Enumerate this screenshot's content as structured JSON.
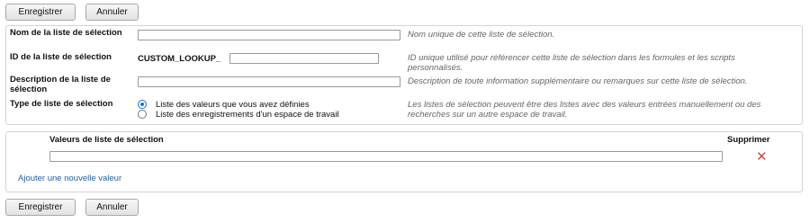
{
  "toolbar": {
    "save_label": "Enregistrer",
    "cancel_label": "Annuler"
  },
  "form": {
    "name": {
      "label": "Nom de la liste de sélection",
      "value": "",
      "help": "Nom unique de cette liste de sélection."
    },
    "id": {
      "label": "ID de la liste de sélection",
      "prefix": "CUSTOM_LOOKUP_",
      "value": "",
      "help": "ID unique utilisé pour référencer cette liste de sélection dans les formules et les scripts personnalisés."
    },
    "description": {
      "label": "Description de la liste de sélection",
      "value": "",
      "help": "Description de toute information supplémentaire ou remarques sur cette liste de sélection."
    },
    "type": {
      "label": "Type de liste de sélection",
      "options": [
        "Liste des valeurs que vous avez définies",
        "Liste des enregistrements d'un espace de travail"
      ],
      "selected_index": 0,
      "help": "Les listes de sélection peuvent être des listes avec des valeurs entrées manuellement ou des recherches sur un autre espace de travail."
    }
  },
  "values_table": {
    "col_values": "Valeurs de liste de sélection",
    "col_delete": "Supprimer",
    "rows": [
      {
        "value": ""
      }
    ],
    "add_link": "Ajouter une nouvelle valeur"
  },
  "icons": {
    "delete": "close-x-icon",
    "delete_color": "#d04a3a"
  }
}
